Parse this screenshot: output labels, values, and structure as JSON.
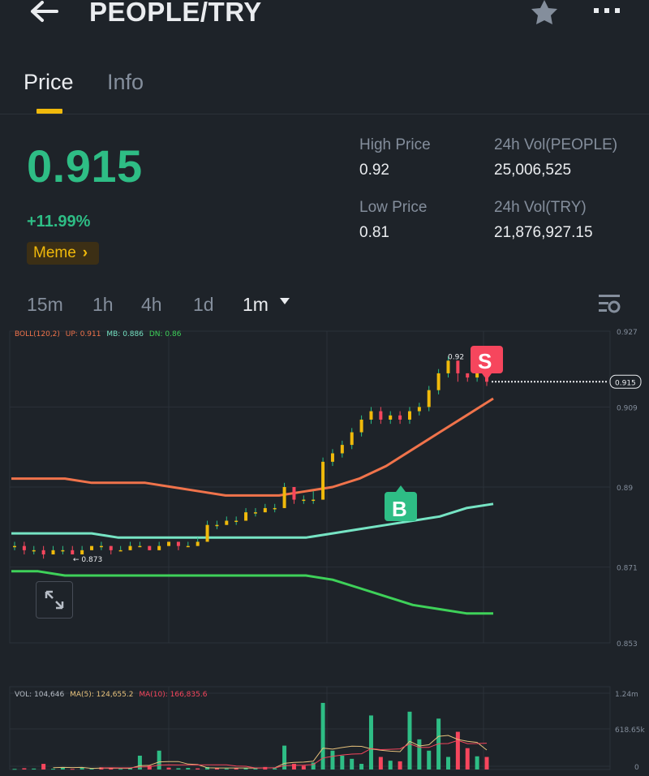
{
  "header": {
    "title": "PEOPLE/TRY",
    "back_icon": "arrow-left-icon",
    "favorite_icon": "star-icon",
    "more_icon": "more-horizontal-icon"
  },
  "tabs": [
    {
      "label": "Price",
      "active": true
    },
    {
      "label": "Info",
      "active": false
    }
  ],
  "ticker": {
    "last_price": "0.915",
    "change_pct": "+11.99%",
    "tag": "Meme",
    "tag_chevron": "›"
  },
  "stats": {
    "high_label": "High Price",
    "high_value": "0.92",
    "low_label": "Low Price",
    "low_value": "0.81",
    "vol_base_label": "24h Vol(PEOPLE)",
    "vol_base_value": "25,006,525",
    "vol_quote_label": "24h Vol(TRY)",
    "vol_quote_value": "21,876,927.15"
  },
  "timeframes": {
    "items": [
      "15m",
      "1h",
      "4h",
      "1d",
      "1m"
    ],
    "selected": "1m"
  },
  "colors": {
    "up": "#2ebd85",
    "down": "#f6465d",
    "accent": "#f0b90b",
    "boll_up": "#f0734b",
    "boll_mb": "#76e4c4",
    "boll_dn": "#3ed159"
  },
  "chart_data": {
    "type": "candlestick",
    "indicator_label": "BOLL(120,2)",
    "up_label": "UP: 0.911",
    "mb_label": "MB: 0.886",
    "dn_label": "DN: 0.86",
    "y_ticks": [
      "0.927",
      "0.909",
      "0.89",
      "0.871",
      "0.853"
    ],
    "ylim": [
      0.853,
      0.927
    ],
    "current_price": "0.915",
    "high_marker": "0.92",
    "low_marker": "0.873",
    "buy_marker": "B",
    "sell_marker": "S",
    "candles": [
      [
        0.876,
        0.876,
        0.877,
        0.875
      ],
      [
        0.876,
        0.875,
        0.877,
        0.874
      ],
      [
        0.875,
        0.875,
        0.876,
        0.874
      ],
      [
        0.875,
        0.874,
        0.876,
        0.873
      ],
      [
        0.874,
        0.875,
        0.876,
        0.874
      ],
      [
        0.875,
        0.875,
        0.876,
        0.874
      ],
      [
        0.875,
        0.874,
        0.876,
        0.874
      ],
      [
        0.874,
        0.875,
        0.876,
        0.874
      ],
      [
        0.875,
        0.876,
        0.876,
        0.875
      ],
      [
        0.876,
        0.876,
        0.877,
        0.875
      ],
      [
        0.876,
        0.875,
        0.876,
        0.874
      ],
      [
        0.875,
        0.875,
        0.876,
        0.875
      ],
      [
        0.875,
        0.876,
        0.877,
        0.875
      ],
      [
        0.876,
        0.876,
        0.877,
        0.876
      ],
      [
        0.876,
        0.875,
        0.876,
        0.875
      ],
      [
        0.875,
        0.876,
        0.877,
        0.875
      ],
      [
        0.876,
        0.877,
        0.877,
        0.876
      ],
      [
        0.877,
        0.876,
        0.877,
        0.875
      ],
      [
        0.876,
        0.876,
        0.877,
        0.876
      ],
      [
        0.876,
        0.877,
        0.878,
        0.876
      ],
      [
        0.877,
        0.881,
        0.882,
        0.877
      ],
      [
        0.881,
        0.881,
        0.882,
        0.88
      ],
      [
        0.881,
        0.882,
        0.883,
        0.881
      ],
      [
        0.882,
        0.882,
        0.883,
        0.881
      ],
      [
        0.882,
        0.884,
        0.885,
        0.882
      ],
      [
        0.884,
        0.884,
        0.885,
        0.883
      ],
      [
        0.884,
        0.885,
        0.886,
        0.884
      ],
      [
        0.885,
        0.885,
        0.886,
        0.884
      ],
      [
        0.885,
        0.89,
        0.891,
        0.885
      ],
      [
        0.89,
        0.887,
        0.89,
        0.886
      ],
      [
        0.887,
        0.887,
        0.888,
        0.886
      ],
      [
        0.887,
        0.887,
        0.889,
        0.886
      ],
      [
        0.887,
        0.896,
        0.897,
        0.887
      ],
      [
        0.896,
        0.898,
        0.899,
        0.895
      ],
      [
        0.898,
        0.9,
        0.901,
        0.897
      ],
      [
        0.9,
        0.903,
        0.904,
        0.899
      ],
      [
        0.903,
        0.906,
        0.907,
        0.902
      ],
      [
        0.906,
        0.908,
        0.909,
        0.905
      ],
      [
        0.908,
        0.906,
        0.909,
        0.905
      ],
      [
        0.906,
        0.907,
        0.908,
        0.905
      ],
      [
        0.907,
        0.906,
        0.908,
        0.905
      ],
      [
        0.906,
        0.908,
        0.909,
        0.905
      ],
      [
        0.908,
        0.909,
        0.91,
        0.907
      ],
      [
        0.909,
        0.913,
        0.914,
        0.908
      ],
      [
        0.913,
        0.917,
        0.918,
        0.912
      ],
      [
        0.917,
        0.92,
        0.921,
        0.916
      ],
      [
        0.92,
        0.917,
        0.92,
        0.915
      ],
      [
        0.917,
        0.916,
        0.917,
        0.915
      ],
      [
        0.916,
        0.918,
        0.92,
        0.915
      ],
      [
        0.918,
        0.915,
        0.919,
        0.914
      ]
    ],
    "boll_up": [
      0.892,
      0.892,
      0.892,
      0.891,
      0.891,
      0.891,
      0.89,
      0.889,
      0.888,
      0.888,
      0.888,
      0.889,
      0.89,
      0.892,
      0.895,
      0.899,
      0.903,
      0.907,
      0.911
    ],
    "boll_mb": [
      0.879,
      0.879,
      0.879,
      0.879,
      0.878,
      0.878,
      0.878,
      0.878,
      0.878,
      0.878,
      0.878,
      0.878,
      0.879,
      0.88,
      0.881,
      0.882,
      0.883,
      0.885,
      0.886
    ],
    "boll_dn": [
      0.87,
      0.87,
      0.869,
      0.869,
      0.869,
      0.869,
      0.869,
      0.869,
      0.869,
      0.869,
      0.869,
      0.869,
      0.868,
      0.866,
      0.864,
      0.862,
      0.861,
      0.86,
      0.86
    ]
  },
  "volume_data": {
    "type": "bar",
    "vol_label": "VOL: 104,646",
    "ma5_label": "MA(5): 124,655.2",
    "ma10_label": "MA(10): 166,835.6",
    "y_ticks": [
      "1.24m",
      "618.65k",
      "0"
    ],
    "ylim": [
      0,
      1240000
    ],
    "values": [
      10000,
      20000,
      15000,
      90000,
      12000,
      30000,
      10000,
      25000,
      14000,
      35000,
      20000,
      12000,
      18000,
      220000,
      60000,
      300000,
      30000,
      20000,
      25000,
      18000,
      40000,
      22000,
      15000,
      26000,
      20000,
      30000,
      40000,
      20000,
      380000,
      90000,
      60000,
      110000,
      1060000,
      300000,
      220000,
      170000,
      90000,
      860000,
      200000,
      140000,
      130000,
      920000,
      480000,
      300000,
      810000,
      200000,
      600000,
      340000,
      210000,
      200000
    ],
    "down_flags": [
      0,
      1,
      0,
      1,
      0,
      0,
      1,
      0,
      0,
      1,
      1,
      0,
      0,
      0,
      1,
      0,
      1,
      0,
      0,
      1,
      0,
      1,
      0,
      1,
      0,
      0,
      1,
      0,
      0,
      1,
      1,
      0,
      0,
      0,
      0,
      0,
      0,
      0,
      1,
      0,
      1,
      0,
      0,
      0,
      0,
      0,
      1,
      1,
      0,
      1
    ]
  }
}
